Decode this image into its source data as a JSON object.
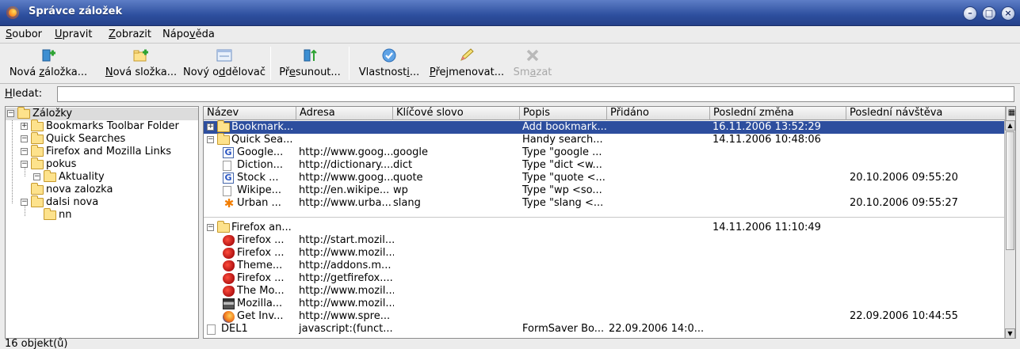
{
  "window": {
    "title": "Správce záložek"
  },
  "menu": [
    "Soubor",
    "Upravit",
    "Zobrazit",
    "Nápověda"
  ],
  "toolbar": {
    "new_bookmark": "Nová záložka...",
    "new_folder": "Nová složka...",
    "new_separator": "Nový oddělovač",
    "move": "Přesunout...",
    "properties": "Vlastnosti...",
    "rename": "Přejmenovat...",
    "delete": "Smazat"
  },
  "search": {
    "label": "Hledat:",
    "value": ""
  },
  "tree": {
    "root": "Záložky",
    "items": [
      "Bookmarks Toolbar Folder",
      "Quick Searches",
      "Firefox and Mozilla Links",
      "pokus",
      "Aktuality",
      "nova zalozka",
      "dalsi nova",
      "nn"
    ]
  },
  "columns": [
    "Název",
    "Adresa",
    "Klíčové slovo",
    "Popis",
    "Přidáno",
    "Poslední změna",
    "Poslední návštěva"
  ],
  "rows": [
    {
      "name": "Bookmark...",
      "url": "",
      "kw": "",
      "desc": "Add bookmark...",
      "added": "",
      "mod": "16.11.2006 13:52:29",
      "visit": ""
    },
    {
      "name": "Quick Sea...",
      "url": "",
      "kw": "",
      "desc": "Handy search...",
      "added": "",
      "mod": "14.11.2006 10:48:06",
      "visit": ""
    },
    {
      "name": "Google...",
      "url": "http://www.goog...",
      "kw": "google",
      "desc": "Type \"google ...",
      "added": "",
      "mod": "",
      "visit": ""
    },
    {
      "name": "Diction...",
      "url": "http://dictionary....",
      "kw": "dict",
      "desc": "Type \"dict <w...",
      "added": "",
      "mod": "",
      "visit": ""
    },
    {
      "name": "Stock ...",
      "url": "http://www.goog...",
      "kw": "quote",
      "desc": "Type \"quote <...",
      "added": "",
      "mod": "",
      "visit": "20.10.2006 09:55:20"
    },
    {
      "name": "Wikipe...",
      "url": "http://en.wikipe...",
      "kw": "wp",
      "desc": "Type \"wp <so...",
      "added": "",
      "mod": "",
      "visit": ""
    },
    {
      "name": "Urban ...",
      "url": "http://www.urba...",
      "kw": "slang",
      "desc": "Type \"slang <...",
      "added": "",
      "mod": "",
      "visit": "20.10.2006 09:55:27"
    },
    {
      "name": "Firefox an...",
      "url": "",
      "kw": "",
      "desc": "",
      "added": "",
      "mod": "14.11.2006 11:10:49",
      "visit": ""
    },
    {
      "name": "Firefox ...",
      "url": "http://start.mozil...",
      "kw": "",
      "desc": "",
      "added": "",
      "mod": "",
      "visit": ""
    },
    {
      "name": "Firefox ...",
      "url": "http://www.mozil...",
      "kw": "",
      "desc": "",
      "added": "",
      "mod": "",
      "visit": ""
    },
    {
      "name": "Theme...",
      "url": "http://addons.m...",
      "kw": "",
      "desc": "",
      "added": "",
      "mod": "",
      "visit": ""
    },
    {
      "name": "Firefox ...",
      "url": "http://getfirefox....",
      "kw": "",
      "desc": "",
      "added": "",
      "mod": "",
      "visit": ""
    },
    {
      "name": "The Mo...",
      "url": "http://www.mozil...",
      "kw": "",
      "desc": "",
      "added": "",
      "mod": "",
      "visit": ""
    },
    {
      "name": "Mozilla...",
      "url": "http://www.mozil...",
      "kw": "",
      "desc": "",
      "added": "",
      "mod": "",
      "visit": ""
    },
    {
      "name": "Get Inv...",
      "url": "http://www.spre...",
      "kw": "",
      "desc": "",
      "added": "",
      "mod": "",
      "visit": "22.09.2006 10:44:55"
    },
    {
      "name": "DEL1",
      "url": "javascript:(funct...",
      "kw": "",
      "desc": "FormSaver Bo...",
      "added": "22.09.2006 14:0...",
      "mod": "",
      "visit": ""
    }
  ],
  "status": "16 objekt(ů)"
}
